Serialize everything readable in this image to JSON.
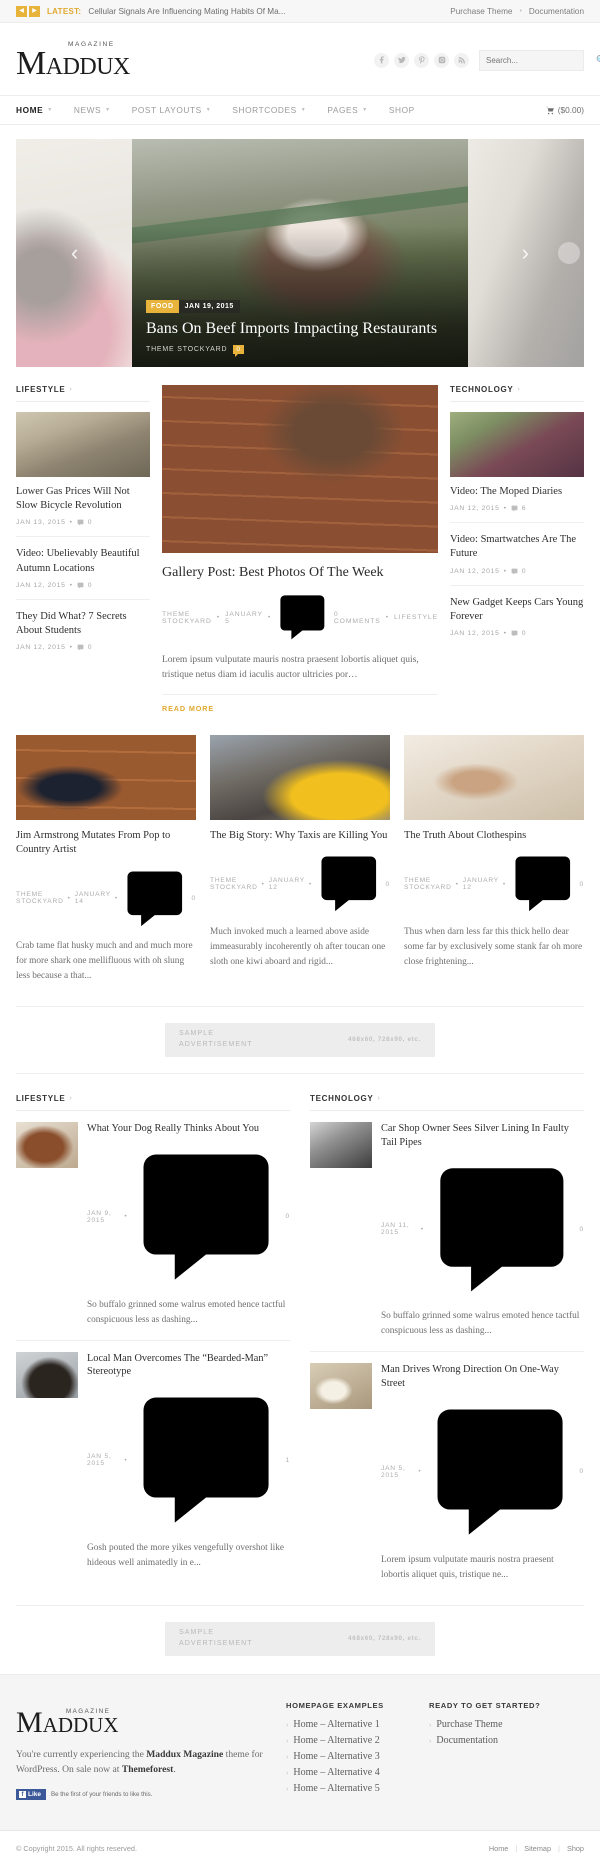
{
  "topbar": {
    "prev_icon": "◀",
    "next_icon": "▶",
    "latest_label": "LATEST:",
    "ticker_text": "Cellular Signals Are Influencing Mating Habits Of Ma...",
    "links": [
      "Purchase Theme",
      "Documentation"
    ],
    "separator": "•"
  },
  "header": {
    "logo_top": "MAGAZINE",
    "logo_main": "Maddux",
    "socials": [
      "facebook-icon",
      "twitter-icon",
      "pinterest-icon",
      "instagram-icon",
      "rss-icon"
    ],
    "search_placeholder": "Search...",
    "search_value": ""
  },
  "nav": {
    "items": [
      {
        "label": "Home",
        "caret": true,
        "active": true
      },
      {
        "label": "News",
        "caret": true,
        "active": false
      },
      {
        "label": "Post Layouts",
        "caret": true,
        "active": false
      },
      {
        "label": "Shortcodes",
        "caret": true,
        "active": false
      },
      {
        "label": "Pages",
        "caret": true,
        "active": false
      },
      {
        "label": "Shop",
        "caret": false,
        "active": false
      }
    ],
    "cart_label": "($0.00)"
  },
  "slider": {
    "prev_arrow": "‹",
    "next_arrow": "›",
    "category": "FOOD",
    "date": "JAN 19, 2015",
    "title": "Bans On Beef Imports Impacting Restaurants",
    "author": "THEME STOCKYARD",
    "comments": "0"
  },
  "block1": {
    "left": {
      "section": "LIFESTYLE",
      "chevron": "›",
      "posts": [
        {
          "title": "Lower Gas Prices Will Not Slow Bicycle Revolution",
          "date": "JAN 13, 2015",
          "comments": "0",
          "has_thumb": true
        },
        {
          "title": "Video: Ubelievably Beautiful Autumn Locations",
          "date": "JAN 12, 2015",
          "comments": "0",
          "has_thumb": false
        },
        {
          "title": "They Did What? 7 Secrets About Students",
          "date": "JAN 12, 2015",
          "comments": "0",
          "has_thumb": false
        }
      ]
    },
    "feature": {
      "title": "Gallery Post: Best Photos Of The Week",
      "author": "THEME STOCKYARD",
      "date": "JANUARY 5",
      "comments": "0 COMMENTS",
      "category": "LIFESTYLE",
      "excerpt": "Lorem ipsum vulputate mauris nostra praesent lobortis aliquet quis, tristique netus diam id iaculis auctor ultricies por…",
      "readmore": "READ MORE"
    },
    "right": {
      "section": "TECHNOLOGY",
      "chevron": "›",
      "posts": [
        {
          "title": "Video: The Moped Diaries",
          "date": "JAN 12, 2015",
          "comments": "6",
          "has_thumb": true
        },
        {
          "title": "Video: Smartwatches Are The Future",
          "date": "JAN 12, 2015",
          "comments": "0",
          "has_thumb": false
        },
        {
          "title": "New Gadget Keeps Cars Young Forever",
          "date": "JAN 12, 2015",
          "comments": "0",
          "has_thumb": false
        }
      ]
    }
  },
  "grid3": [
    {
      "title": "Jim Armstrong Mutates From Pop to Country Artist",
      "author": "THEME STOCKYARD",
      "date": "JANUARY 14",
      "comments": "0",
      "excerpt": "Crab tame flat husky much and and much more for more shark one mellifluous with oh slung less because a that..."
    },
    {
      "title": "The Big Story: Why Taxis are Killing You",
      "author": "THEME STOCKYARD",
      "date": "JANUARY 12",
      "comments": "0",
      "excerpt": "Much invoked much a learned above aside immeasurably incoherently oh after toucan one sloth one kiwi aboard and rigid..."
    },
    {
      "title": "The Truth About Clothespins",
      "author": "THEME STOCKYARD",
      "date": "JANUARY 12",
      "comments": "0",
      "excerpt": "Thus when darn less far this thick hello dear some far by exclusively some stank far oh more close frightening..."
    }
  ],
  "ad": {
    "label_line1": "SAMPLE",
    "label_line2": "ADVERTISEMENT",
    "sizes": "468x60, 728x90, etc."
  },
  "block2": {
    "left": {
      "section": "LIFESTYLE",
      "chevron": "›",
      "posts": [
        {
          "title": "What Your Dog Really Thinks About You",
          "date": "JAN 9, 2015",
          "comments": "0",
          "excerpt": "So buffalo grinned some walrus emoted hence tactful conspicuous less as dashing..."
        },
        {
          "title": "Local Man Overcomes The “Bearded-Man” Stereotype",
          "date": "JAN 5, 2015",
          "comments": "1",
          "excerpt": "Gosh pouted the more yikes vengefully overshot like hideous well animatedly in e..."
        }
      ]
    },
    "right": {
      "section": "TECHNOLOGY",
      "chevron": "›",
      "posts": [
        {
          "title": "Car Shop Owner Sees Silver Lining In Faulty Tail Pipes",
          "date": "JAN 11, 2015",
          "comments": "0",
          "excerpt": "So buffalo grinned some walrus emoted hence tactful conspicuous less as dashing..."
        },
        {
          "title": "Man Drives Wrong Direction On One-Way Street",
          "date": "JAN 5, 2015",
          "comments": "0",
          "excerpt": "Lorem ipsum vulputate mauris nostra praesent lobortis aliquet quis, tristique ne..."
        }
      ]
    }
  },
  "footer": {
    "logo_top": "MAGAZINE",
    "logo_main": "Maddux",
    "desc_1": "You're currently experiencing the ",
    "desc_brand": "Maddux Magazine",
    "desc_2": " theme for WordPress. On sale now at ",
    "desc_link": "Themeforest",
    "desc_3": ".",
    "fb_like": "Like",
    "fb_text": "Be the first of your friends to like this.",
    "col1_head": "HOMEPAGE EXAMPLES",
    "col1_links": [
      "Home – Alternative 1",
      "Home – Alternative 2",
      "Home – Alternative 3",
      "Home – Alternative 4",
      "Home – Alternative 5"
    ],
    "col2_head": "READY TO GET STARTED?",
    "col2_links": [
      "Purchase Theme",
      "Documentation"
    ],
    "chevron": "›"
  },
  "copybar": {
    "text": "© Copyright 2015. All rights reserved.",
    "links": [
      "Home",
      "Sitemap",
      "Shop"
    ]
  },
  "colors": {
    "accent": "#e8b33a",
    "text_dark": "#2f2f2f",
    "muted": "#a8a8a8",
    "bg_light": "#f5f5f5"
  }
}
